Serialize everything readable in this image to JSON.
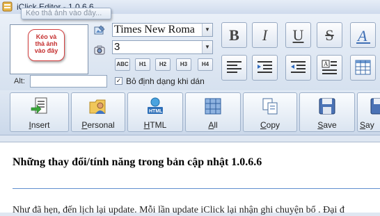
{
  "window": {
    "title": "iClick Editor - 1.0.6.6"
  },
  "tooltip": {
    "text": "Kéo thả ảnh vào đây..."
  },
  "image_panel": {
    "callout_lines": [
      "Kéo và",
      "thả ảnh",
      "vào đây"
    ],
    "alt_label": "Alt:",
    "alt_value": ""
  },
  "font": {
    "family_value": "Times New Roma",
    "size_value": "3"
  },
  "headings": [
    "ABC",
    "H1",
    "H2",
    "H3",
    "H4"
  ],
  "options": {
    "checkbox_label": "Bỏ định dạng khi dán",
    "checked": true
  },
  "format_buttons": [
    "B",
    "I",
    "U",
    "S"
  ],
  "toolbar": {
    "insert": {
      "underline_char": "I",
      "rest": "nsert"
    },
    "personal": {
      "underline_char": "P",
      "rest": "ersonal"
    },
    "html": {
      "underline_char": "H",
      "rest": "TML"
    },
    "all": {
      "underline_char": "A",
      "rest": "ll"
    },
    "copy": {
      "underline_char": "C",
      "rest": "opy"
    },
    "save": {
      "underline_char": "S",
      "rest": "ave"
    },
    "save_as": {
      "underline_char": "S",
      "rest": "ay"
    }
  },
  "document": {
    "title": "Những thay đổi/tính năng trong bản cập nhật 1.0.6.6",
    "paragraph": "Như đã hẹn, đến lịch lại update. Mỗi lần update iClick lại nhận ghi chuyện bổ . Đại đ"
  },
  "colors": {
    "accent": "#5f8fcf",
    "callout_border": "#d44040"
  }
}
